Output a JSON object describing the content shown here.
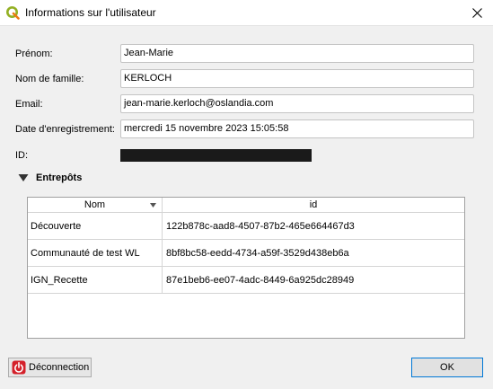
{
  "window": {
    "title": "Informations sur l'utilisateur",
    "close_icon": "close-icon",
    "app_icon": "qgis-icon"
  },
  "form": {
    "firstname_label": "Prénom:",
    "firstname_value": "Jean-Marie",
    "lastname_label": "Nom de famille:",
    "lastname_value": "KERLOCH",
    "email_label": "Email:",
    "email_value": "jean-marie.kerloch@oslandia.com",
    "registration_label": "Date d'enregistrement:",
    "registration_value": "mercredi 15 novembre 2023 15:05:58",
    "id_label": "ID:"
  },
  "stores": {
    "title": "Entrepôts",
    "columns": [
      "Nom",
      "id"
    ],
    "rows": [
      {
        "name": "Découverte",
        "id": "122b878c-aad8-4507-87b2-465e664467d3"
      },
      {
        "name": "Communauté de test WL",
        "id": "8bf8bc58-eedd-4734-a59f-3529d438eb6a"
      },
      {
        "name": "IGN_Recette",
        "id": "87e1beb6-ee07-4adc-8449-6a925dc28949"
      }
    ]
  },
  "buttons": {
    "logout_label": "Déconnection",
    "ok_label": "OK"
  },
  "colors": {
    "accent": "#0078d7",
    "logo_green": "#93b023",
    "logout_red": "#d4202a"
  }
}
